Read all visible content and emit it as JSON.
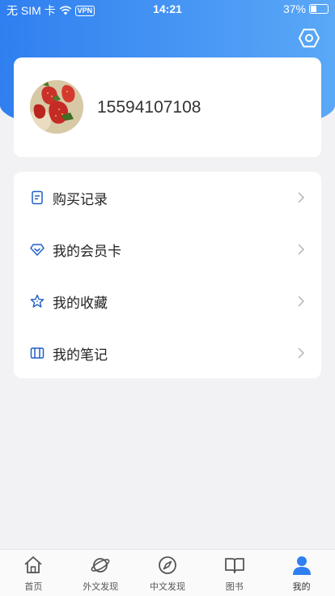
{
  "status_bar": {
    "carrier": "无 SIM 卡",
    "vpn": "VPN",
    "time": "14:21",
    "battery": "37%",
    "battery_level": 0.37
  },
  "profile": {
    "phone": "15594107108"
  },
  "menu": [
    {
      "label": "购买记录",
      "icon": "receipt-icon"
    },
    {
      "label": "我的会员卡",
      "icon": "diamond-icon"
    },
    {
      "label": "我的收藏",
      "icon": "star-icon"
    },
    {
      "label": "我的笔记",
      "icon": "notebook-icon"
    }
  ],
  "tabs": [
    {
      "label": "首页",
      "icon": "home-icon"
    },
    {
      "label": "外文发现",
      "icon": "planet-icon"
    },
    {
      "label": "中文发现",
      "icon": "compass-icon"
    },
    {
      "label": "图书",
      "icon": "book-icon"
    },
    {
      "label": "我的",
      "icon": "person-icon",
      "active": true
    }
  ],
  "colors": {
    "accent": "#2f7ff0",
    "icon_blue": "#1e5fc8"
  }
}
